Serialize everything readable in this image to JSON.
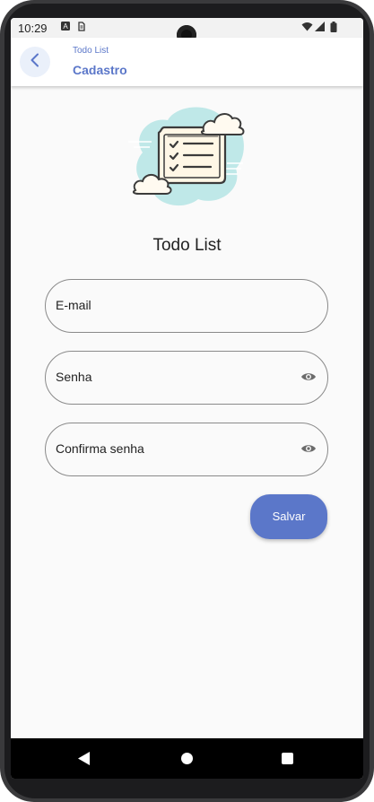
{
  "status_bar": {
    "time": "10:29",
    "icons": [
      "a-notification-icon",
      "sim-icon",
      "wifi-icon",
      "signal-icon",
      "battery-icon"
    ]
  },
  "app_bar": {
    "subtitle": "Todo List",
    "title": "Cadastro",
    "back_icon": "chevron-left-icon"
  },
  "main": {
    "heading": "Todo List",
    "illustration": "checklist-clouds-illustration",
    "fields": {
      "email_label": "E-mail",
      "password_label": "Senha",
      "confirm_password_label": "Confirma senha",
      "visibility_icon": "eye-icon"
    },
    "save_label": "Salvar"
  },
  "colors": {
    "accent": "#5b77c9",
    "background": "#fafafa",
    "field_border": "#8a8a8a",
    "illustration_bg": "#bfe8e8"
  },
  "nav_bar": {
    "icons": [
      "back-triangle-icon",
      "home-circle-icon",
      "recents-square-icon"
    ]
  }
}
